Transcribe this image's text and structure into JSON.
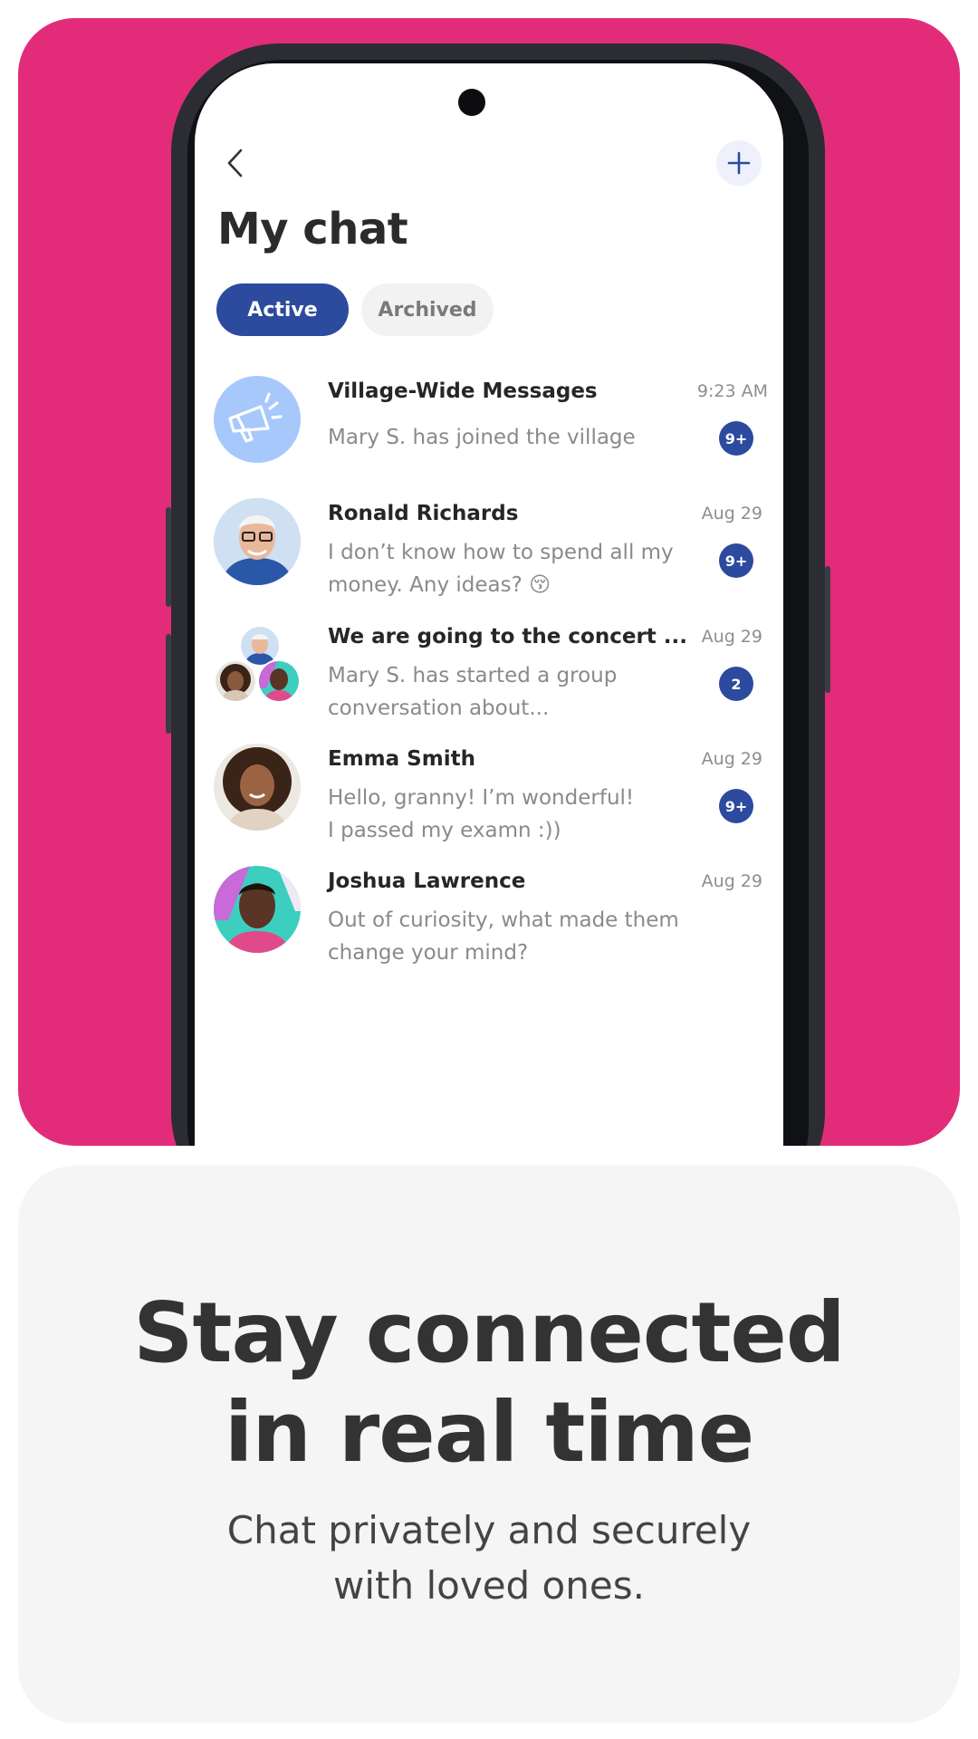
{
  "app": {
    "title": "My chat",
    "tabs": [
      {
        "label": "Active",
        "selected": true
      },
      {
        "label": "Archived",
        "selected": false
      }
    ]
  },
  "chats": [
    {
      "name": "Village-Wide Messages",
      "message": "Mary S. has joined the village",
      "time": "9:23 AM",
      "badge": "9+",
      "avatar": "megaphone-icon"
    },
    {
      "name": "Ronald Richards",
      "message": "I don’t know how to spend all my money. Any ideas? 😚",
      "time": "Aug 29",
      "badge": "9+",
      "avatar": "ronald-avatar"
    },
    {
      "name": "We are going to the concert ...",
      "message": "Mary S. has started a group conversation about...",
      "time": "Aug 29",
      "badge": "2",
      "avatar": "group-avatar"
    },
    {
      "name": "Emma Smith",
      "message": "Hello, granny! I’m wonderful! I passed my examn :))",
      "time": "Aug 29",
      "badge": "9+",
      "avatar": "emma-avatar"
    },
    {
      "name": "Joshua Lawrence",
      "message": "Out of curiosity, what made them change your mind?",
      "time": "Aug 29",
      "badge": "",
      "avatar": "joshua-avatar"
    }
  ],
  "promo": {
    "headline_line1": "Stay connected",
    "headline_line2": "in real time",
    "subtitle_line1": "Chat privately and securely",
    "subtitle_line2": "with loved ones."
  },
  "colors": {
    "hero_bg": "#e22c7a",
    "accent": "#2c4a9e",
    "card_bg": "#f5f5f5"
  }
}
